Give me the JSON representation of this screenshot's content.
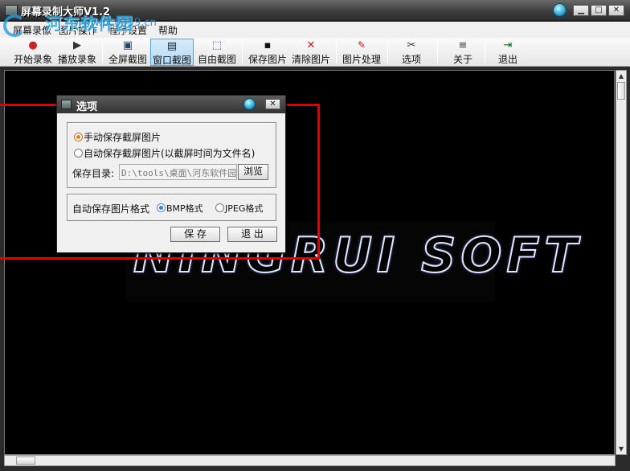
{
  "window": {
    "title": "屏幕录制大师V1.2",
    "minimize": "▁",
    "maximize": "□",
    "close": "✕"
  },
  "watermark": {
    "text": "河东软件园",
    "url": "www.pc0359.cn"
  },
  "menu": [
    {
      "label": "屏幕录像"
    },
    {
      "label": "图片操作"
    },
    {
      "label": "程序设置"
    },
    {
      "label": "帮助"
    }
  ],
  "toolbar": [
    {
      "label": "开始录象",
      "icon": "record-icon",
      "glyph": "●"
    },
    {
      "label": "播放录象",
      "icon": "play-icon",
      "glyph": "▶"
    },
    {
      "label": "全屏截图",
      "icon": "fullscreen-capture-icon",
      "glyph": "▣"
    },
    {
      "label": "窗口截图",
      "icon": "window-capture-icon",
      "glyph": "▤"
    },
    {
      "label": "自由截图",
      "icon": "free-capture-icon",
      "glyph": "⬚"
    },
    {
      "label": "保存图片",
      "icon": "save-icon",
      "glyph": "▪"
    },
    {
      "label": "清除图片",
      "icon": "clear-icon",
      "glyph": "✕"
    },
    {
      "label": "图片处理",
      "icon": "edit-icon",
      "glyph": "✎"
    },
    {
      "label": "选项",
      "icon": "options-icon",
      "glyph": "✂"
    },
    {
      "label": "关于",
      "icon": "about-icon",
      "glyph": "≡"
    },
    {
      "label": "退出",
      "icon": "exit-icon",
      "glyph": "⇥"
    }
  ],
  "canvas": {
    "logo_text": "NINGRUI SOFT"
  },
  "dialog": {
    "title": "选项",
    "manual_save": "手动保存截屏图片",
    "auto_save": "自动保存截屏图片(以截屏时间为文件名)",
    "save_dir_label": "保存目录:",
    "save_dir_value": "D:\\tools\\桌面\\河东软件园",
    "browse": "浏览",
    "format_label": "自动保存图片格式",
    "format_bmp": "BMP格式",
    "format_jpeg": "JPEG格式",
    "save_button": "保 存",
    "exit_button": "退 出"
  },
  "colors": {
    "selection": "#e00000",
    "canvas_bg": "#000000",
    "accent": "#29a6e0"
  }
}
